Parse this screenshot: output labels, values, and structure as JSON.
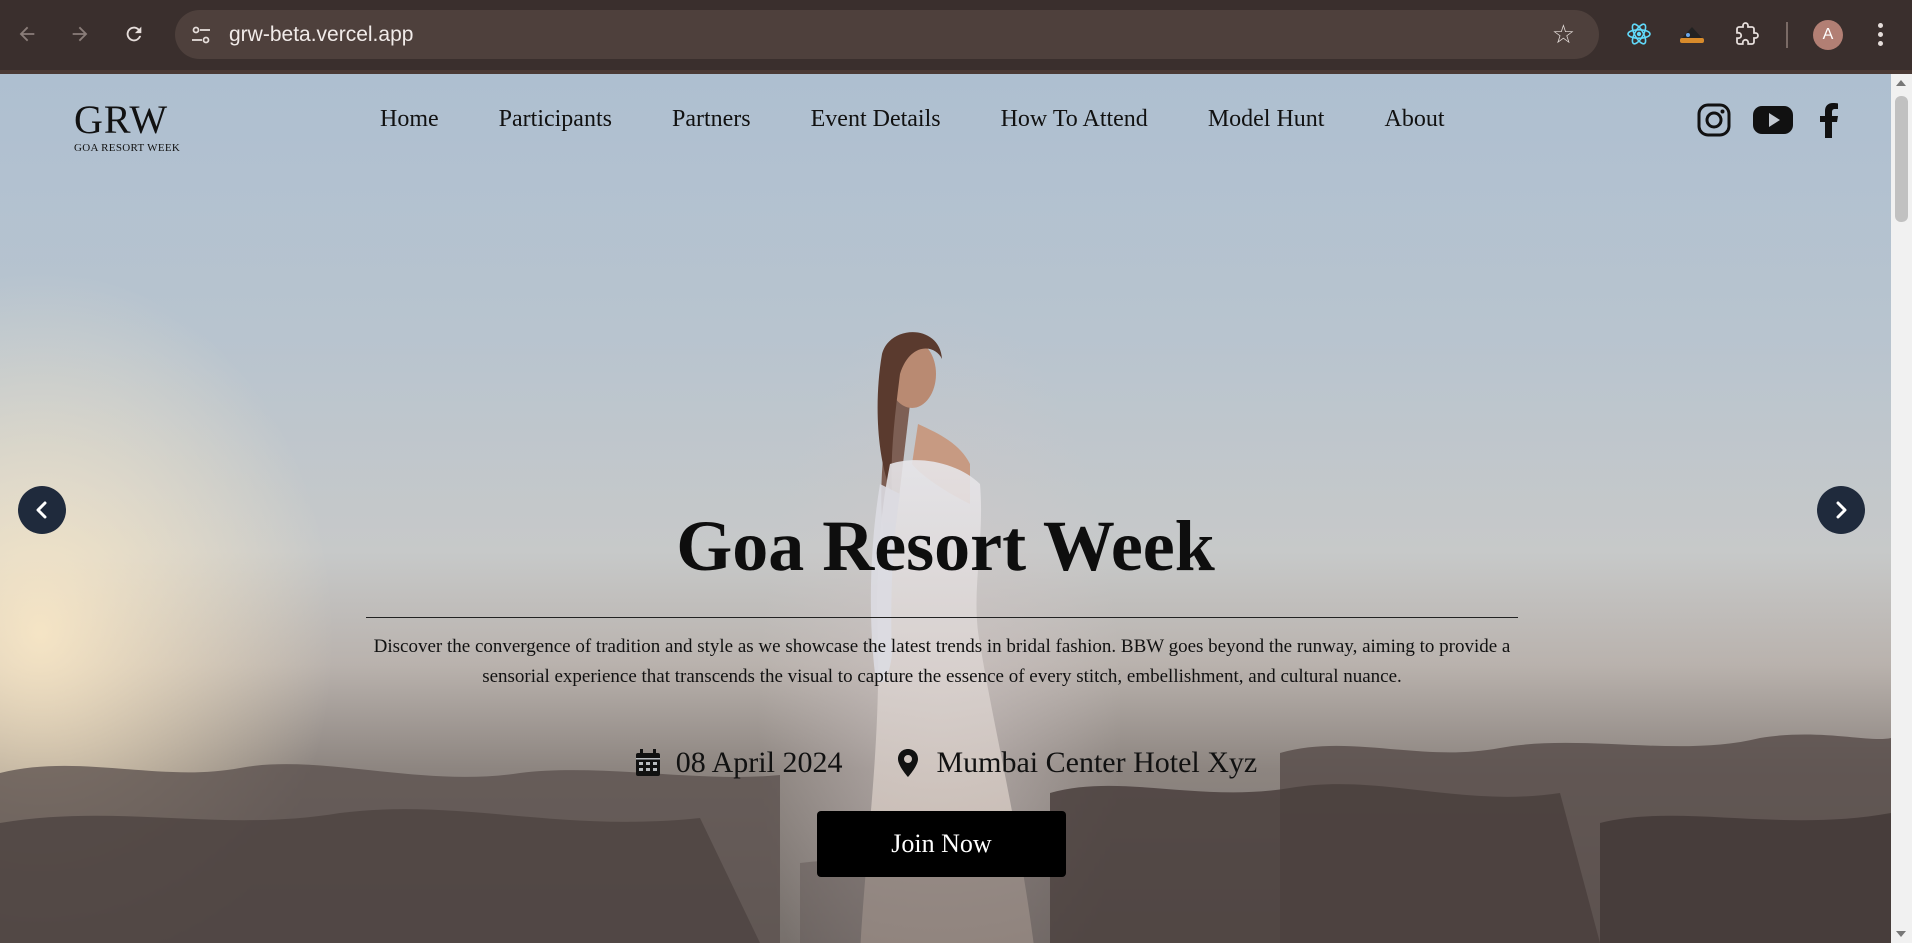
{
  "browser": {
    "url": "grw-beta.vercel.app",
    "profile_initial": "A",
    "icons": {
      "back": "arrow-left-icon",
      "forward": "arrow-right-icon",
      "reload": "reload-icon",
      "site_info": "tune-icon",
      "bookmark": "star-icon",
      "extensions": [
        "react-devtools-icon",
        "extension-hat-icon",
        "puzzle-icon"
      ],
      "menu": "kebab-menu-icon"
    }
  },
  "site": {
    "logo": {
      "title": "GRW",
      "subtitle": "GOA RESORT WEEK"
    },
    "nav": [
      {
        "label": "Home"
      },
      {
        "label": "Participants"
      },
      {
        "label": "Partners"
      },
      {
        "label": "Event Details"
      },
      {
        "label": "How To Attend"
      },
      {
        "label": "Model Hunt"
      },
      {
        "label": "About"
      }
    ],
    "social": [
      "instagram-icon",
      "youtube-icon",
      "facebook-icon"
    ]
  },
  "hero": {
    "title": "Goa Resort Week",
    "description": "Discover the convergence of tradition and style as we showcase the latest trends in bridal fashion. BBW goes beyond the runway, aiming to provide a sensorial experience that transcends the visual to capture the essence of every stitch, embellishment, and cultural nuance.",
    "date": "08 April 2024",
    "location": "Mumbai Center Hotel Xyz",
    "cta_label": "Join Now"
  },
  "colors": {
    "chrome_bg": "#3a2f2d",
    "omnibox_bg": "#4e403c",
    "cta_bg": "#000000",
    "carousel_arrow_bg": "#1f2a3c"
  }
}
